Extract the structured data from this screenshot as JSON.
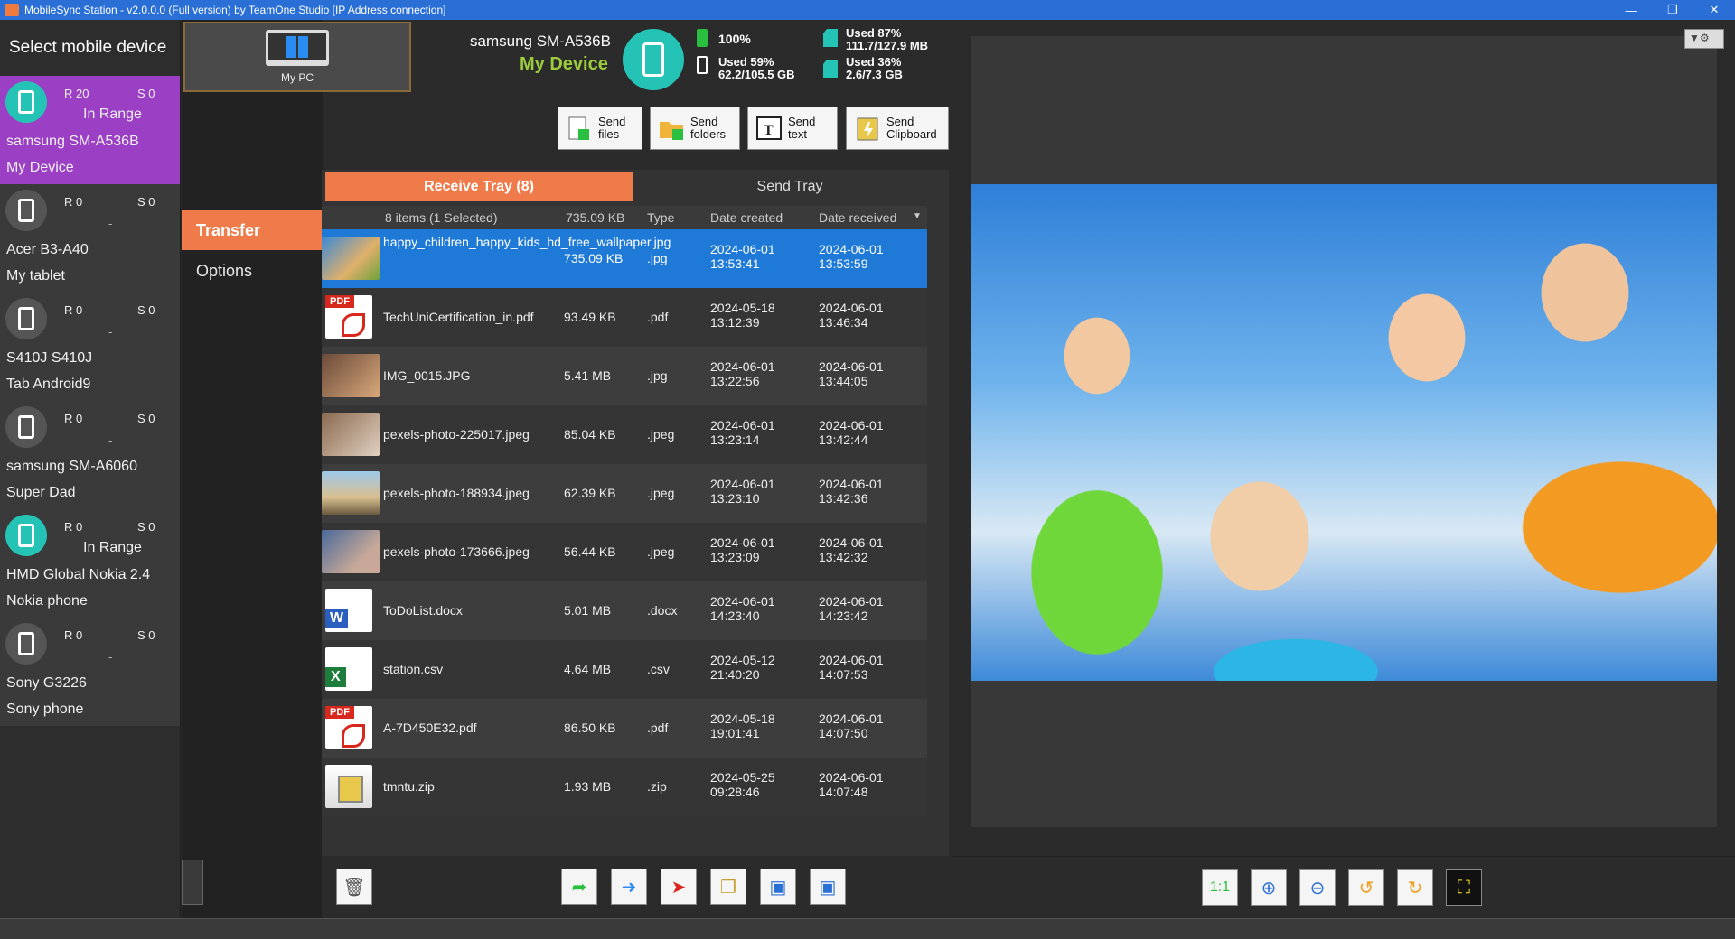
{
  "window": {
    "title": "MobileSync Station - v2.0.0.0 (Full version) by TeamOne Studio [IP Address connection]"
  },
  "sidebar": {
    "heading": "Select mobile device",
    "devices": [
      {
        "r": "R 20",
        "s": "S 0",
        "status": "In Range",
        "name": "samsung SM-A536B",
        "nick": "My Device",
        "active": true,
        "inrange": true
      },
      {
        "r": "R 0",
        "s": "S 0",
        "status": "-",
        "name": "Acer B3-A40",
        "nick": "My tablet",
        "active": false,
        "inrange": false
      },
      {
        "r": "R 0",
        "s": "S 0",
        "status": "-",
        "name": "S410J S410J",
        "nick": "Tab Android9",
        "active": false,
        "inrange": false
      },
      {
        "r": "R 0",
        "s": "S 0",
        "status": "-",
        "name": "samsung SM-A6060",
        "nick": "Super Dad",
        "active": false,
        "inrange": false
      },
      {
        "r": "R 0",
        "s": "S 0",
        "status": "In Range",
        "name": "HMD Global Nokia 2.4",
        "nick": "Nokia phone",
        "active": false,
        "inrange": true
      },
      {
        "r": "R 0",
        "s": "S 0",
        "status": "-",
        "name": "Sony G3226",
        "nick": "Sony phone",
        "active": false,
        "inrange": false
      }
    ]
  },
  "nav": {
    "mypc": "My PC",
    "items": [
      "Transfer",
      "Options"
    ]
  },
  "device_header": {
    "name": "samsung SM-A536B",
    "nick": "My Device",
    "battery": "100%",
    "storage_used": "Used 59%",
    "storage_amount": "62.2/105.5 GB",
    "sd1_used": "Used 87%",
    "sd1_amount": "111.7/127.9 MB",
    "sd2_used": "Used 36%",
    "sd2_amount": "2.6/7.3 GB"
  },
  "send_buttons": [
    {
      "line1": "Send",
      "line2": "files",
      "icon": "send-files-icon"
    },
    {
      "line1": "Send",
      "line2": "folders",
      "icon": "send-folders-icon"
    },
    {
      "line1": "Send",
      "line2": "text",
      "icon": "send-text-icon"
    },
    {
      "line1": "Send",
      "line2": "Clipboard",
      "icon": "send-clipboard-icon"
    }
  ],
  "tray": {
    "receive_tab": "Receive Tray (8)",
    "send_tab": "Send Tray",
    "summary": "8 items (1 Selected)",
    "total_size": "735.09 KB",
    "col_type": "Type",
    "col_created": "Date created",
    "col_received": "Date received",
    "rows": [
      {
        "name": "happy_children_happy_kids_hd_free_wallpaper.jpg",
        "size": "735.09 KB",
        "type": ".jpg",
        "created_date": "2024-06-01",
        "created_time": "13:53:41",
        "received_date": "2024-06-01",
        "received_time": "13:53:59",
        "thumb": "img",
        "selected": true
      },
      {
        "name": "TechUniCertification_in.pdf",
        "size": "93.49 KB",
        "type": ".pdf",
        "created_date": "2024-05-18",
        "created_time": "13:12:39",
        "received_date": "2024-06-01",
        "received_time": "13:46:34",
        "thumb": "pdf",
        "selected": false
      },
      {
        "name": "IMG_0015.JPG",
        "size": "5.41 MB",
        "type": ".jpg",
        "created_date": "2024-06-01",
        "created_time": "13:22:56",
        "received_date": "2024-06-01",
        "received_time": "13:44:05",
        "thumb": "img2",
        "selected": false
      },
      {
        "name": "pexels-photo-225017.jpeg",
        "size": "85.04 KB",
        "type": ".jpeg",
        "created_date": "2024-06-01",
        "created_time": "13:23:14",
        "received_date": "2024-06-01",
        "received_time": "13:42:44",
        "thumb": "img5",
        "selected": false
      },
      {
        "name": "pexels-photo-188934.jpeg",
        "size": "62.39 KB",
        "type": ".jpeg",
        "created_date": "2024-06-01",
        "created_time": "13:23:10",
        "received_date": "2024-06-01",
        "received_time": "13:42:36",
        "thumb": "img3",
        "selected": false
      },
      {
        "name": "pexels-photo-173666.jpeg",
        "size": "56.44 KB",
        "type": ".jpeg",
        "created_date": "2024-06-01",
        "created_time": "13:23:09",
        "received_date": "2024-06-01",
        "received_time": "13:42:32",
        "thumb": "img4",
        "selected": false
      },
      {
        "name": "ToDoList.docx",
        "size": "5.01 MB",
        "type": ".docx",
        "created_date": "2024-06-01",
        "created_time": "14:23:40",
        "received_date": "2024-06-01",
        "received_time": "14:23:42",
        "thumb": "word",
        "selected": false
      },
      {
        "name": "station.csv",
        "size": "4.64 MB",
        "type": ".csv",
        "created_date": "2024-05-12",
        "created_time": "21:40:20",
        "received_date": "2024-06-01",
        "received_time": "14:07:53",
        "thumb": "excel",
        "selected": false
      },
      {
        "name": "A-7D450E32.pdf",
        "size": "86.50 KB",
        "type": ".pdf",
        "created_date": "2024-05-18",
        "created_time": "19:01:41",
        "received_date": "2024-06-01",
        "received_time": "14:07:50",
        "thumb": "pdf",
        "selected": false
      },
      {
        "name": "tmntu.zip",
        "size": "1.93 MB",
        "type": ".zip",
        "created_date": "2024-05-25",
        "created_time": "09:28:46",
        "received_date": "2024-06-01",
        "received_time": "14:07:48",
        "thumb": "zip",
        "selected": false
      }
    ]
  },
  "colors": {
    "accent_orange": "#f07b4a",
    "selected_blue": "#1e7ad6",
    "device_purple": "#9b3fc4",
    "device_teal": "#25c3b5",
    "nick_green": "#9ccc3c",
    "titlebar_blue": "#2a6fd6"
  }
}
